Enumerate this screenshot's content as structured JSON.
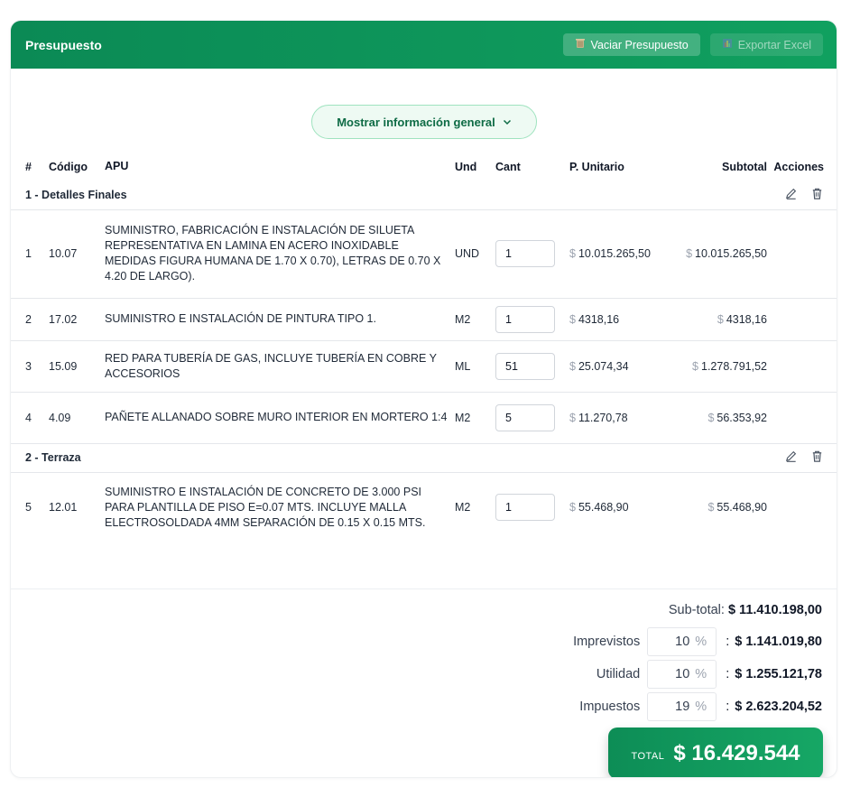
{
  "header": {
    "title": "Presupuesto",
    "clear_label": "Vaciar Presupuesto",
    "export_label": "Exportar Excel"
  },
  "toggle": {
    "label": "Mostrar información general"
  },
  "table": {
    "headers": [
      "#",
      "Código",
      "APU",
      "Und",
      "Cant",
      "P. Unitario",
      "Subtotal",
      "Acciones"
    ],
    "currency": "$",
    "groups": [
      {
        "label": "1 -  Detalles Finales",
        "items": [
          {
            "num": "1",
            "code": "10.07",
            "apu": "SUMINISTRO, FABRICACIÓN E INSTALACIÓN DE SILUETA REPRESENTATIVA EN LAMINA EN ACERO INOXIDABLE MEDIDAS FIGURA HUMANA DE 1.70 X 0.70), LETRAS DE 0.70 X 4.20 DE LARGO).",
            "und": "UND",
            "cant": "1",
            "unit": "10.015.265,50",
            "subtotal": "10.015.265,50"
          },
          {
            "num": "2",
            "code": "17.02",
            "apu": "SUMINISTRO E INSTALACIÓN DE PINTURA TIPO 1.",
            "und": "M2",
            "cant": "1",
            "unit": "4318,16",
            "subtotal": "4318,16"
          },
          {
            "num": "3",
            "code": "15.09",
            "apu": "RED PARA TUBERÍA DE GAS, INCLUYE TUBERÍA EN COBRE Y ACCESORIOS",
            "und": "ML",
            "cant": "51",
            "unit": "25.074,34",
            "subtotal": "1.278.791,52"
          },
          {
            "num": "4",
            "code": "4.09",
            "apu": "PAÑETE ALLANADO SOBRE MURO INTERIOR EN MORTERO 1:4",
            "und": "M2",
            "cant": "5",
            "unit": "11.270,78",
            "subtotal": "56.353,92"
          }
        ]
      },
      {
        "label": "2 -  Terraza",
        "items": [
          {
            "num": "5",
            "code": "12.01",
            "apu": "SUMINISTRO E INSTALACIÓN DE CONCRETO DE 3.000 PSI PARA PLANTILLA DE PISO E=0.07 MTS. INCLUYE MALLA ELECTROSOLDADA 4MM SEPARACIÓN DE 0.15 X 0.15 MTS.",
            "und": "M2",
            "cant": "1",
            "unit": "55.468,90",
            "subtotal": "55.468,90"
          }
        ]
      }
    ]
  },
  "totals": {
    "subtotal_label": "Sub-total:",
    "subtotal_value": "$ 11.410.198,00",
    "rows": [
      {
        "label": "Imprevistos",
        "pct": "10",
        "value": "$ 1.141.019,80"
      },
      {
        "label": "Utilidad",
        "pct": "10",
        "value": "$ 1.255.121,78"
      },
      {
        "label": "Impuestos",
        "pct": "19",
        "value": "$ 2.623.204,52"
      }
    ],
    "pct_symbol": "%",
    "total_label": "TOTAL",
    "total_value": "$ 16.429.544"
  },
  "colors": {
    "brand": "#0b8a55",
    "accent_light": "#eefaf3"
  },
  "icons": [
    "wastebasket-icon",
    "spreadsheet-icon",
    "chevron-down-icon",
    "pencil-icon",
    "trash-icon"
  ]
}
